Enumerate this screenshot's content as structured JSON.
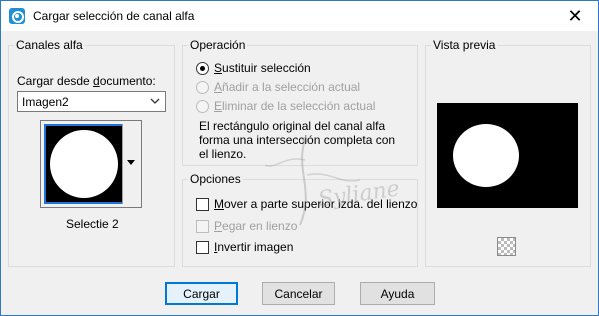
{
  "window": {
    "title": "Cargar selección de canal alfa",
    "close_glyph": "✕"
  },
  "channels": {
    "legend": "Canales alfa",
    "load_label_pre": "Cargar desde ",
    "load_label_u": "d",
    "load_label_post": "ocumento:",
    "document": "Imagen2",
    "channel_name": "Selectie 2"
  },
  "operation": {
    "legend": "Operación",
    "options": [
      {
        "u": "S",
        "rest": "ustituir selección",
        "checked": true,
        "enabled": true
      },
      {
        "u": "A",
        "rest": "ñadir a la selección actual",
        "checked": false,
        "enabled": false
      },
      {
        "u": "E",
        "rest": "liminar de la selección actual",
        "checked": false,
        "enabled": false
      }
    ],
    "description": "El rectángulo original del canal alfa forma una intersección completa con el lienzo."
  },
  "options": {
    "legend": "Opciones",
    "items": [
      {
        "u": "M",
        "rest": "over a parte superior izda. del lienzo",
        "checked": false,
        "enabled": true
      },
      {
        "u": "P",
        "rest": "egar en lienzo",
        "checked": false,
        "enabled": false
      },
      {
        "u": "I",
        "rest": "nvertir imagen",
        "checked": false,
        "enabled": true
      }
    ]
  },
  "preview": {
    "legend": "Vista previa"
  },
  "watermark": "Syliane",
  "buttons": {
    "load": "Cargar",
    "cancel": "Cancelar",
    "help": "Ayuda"
  },
  "colors": {
    "accent": "#0078d7",
    "title_border": "#2b79c7",
    "background": "#f0f0f0"
  }
}
